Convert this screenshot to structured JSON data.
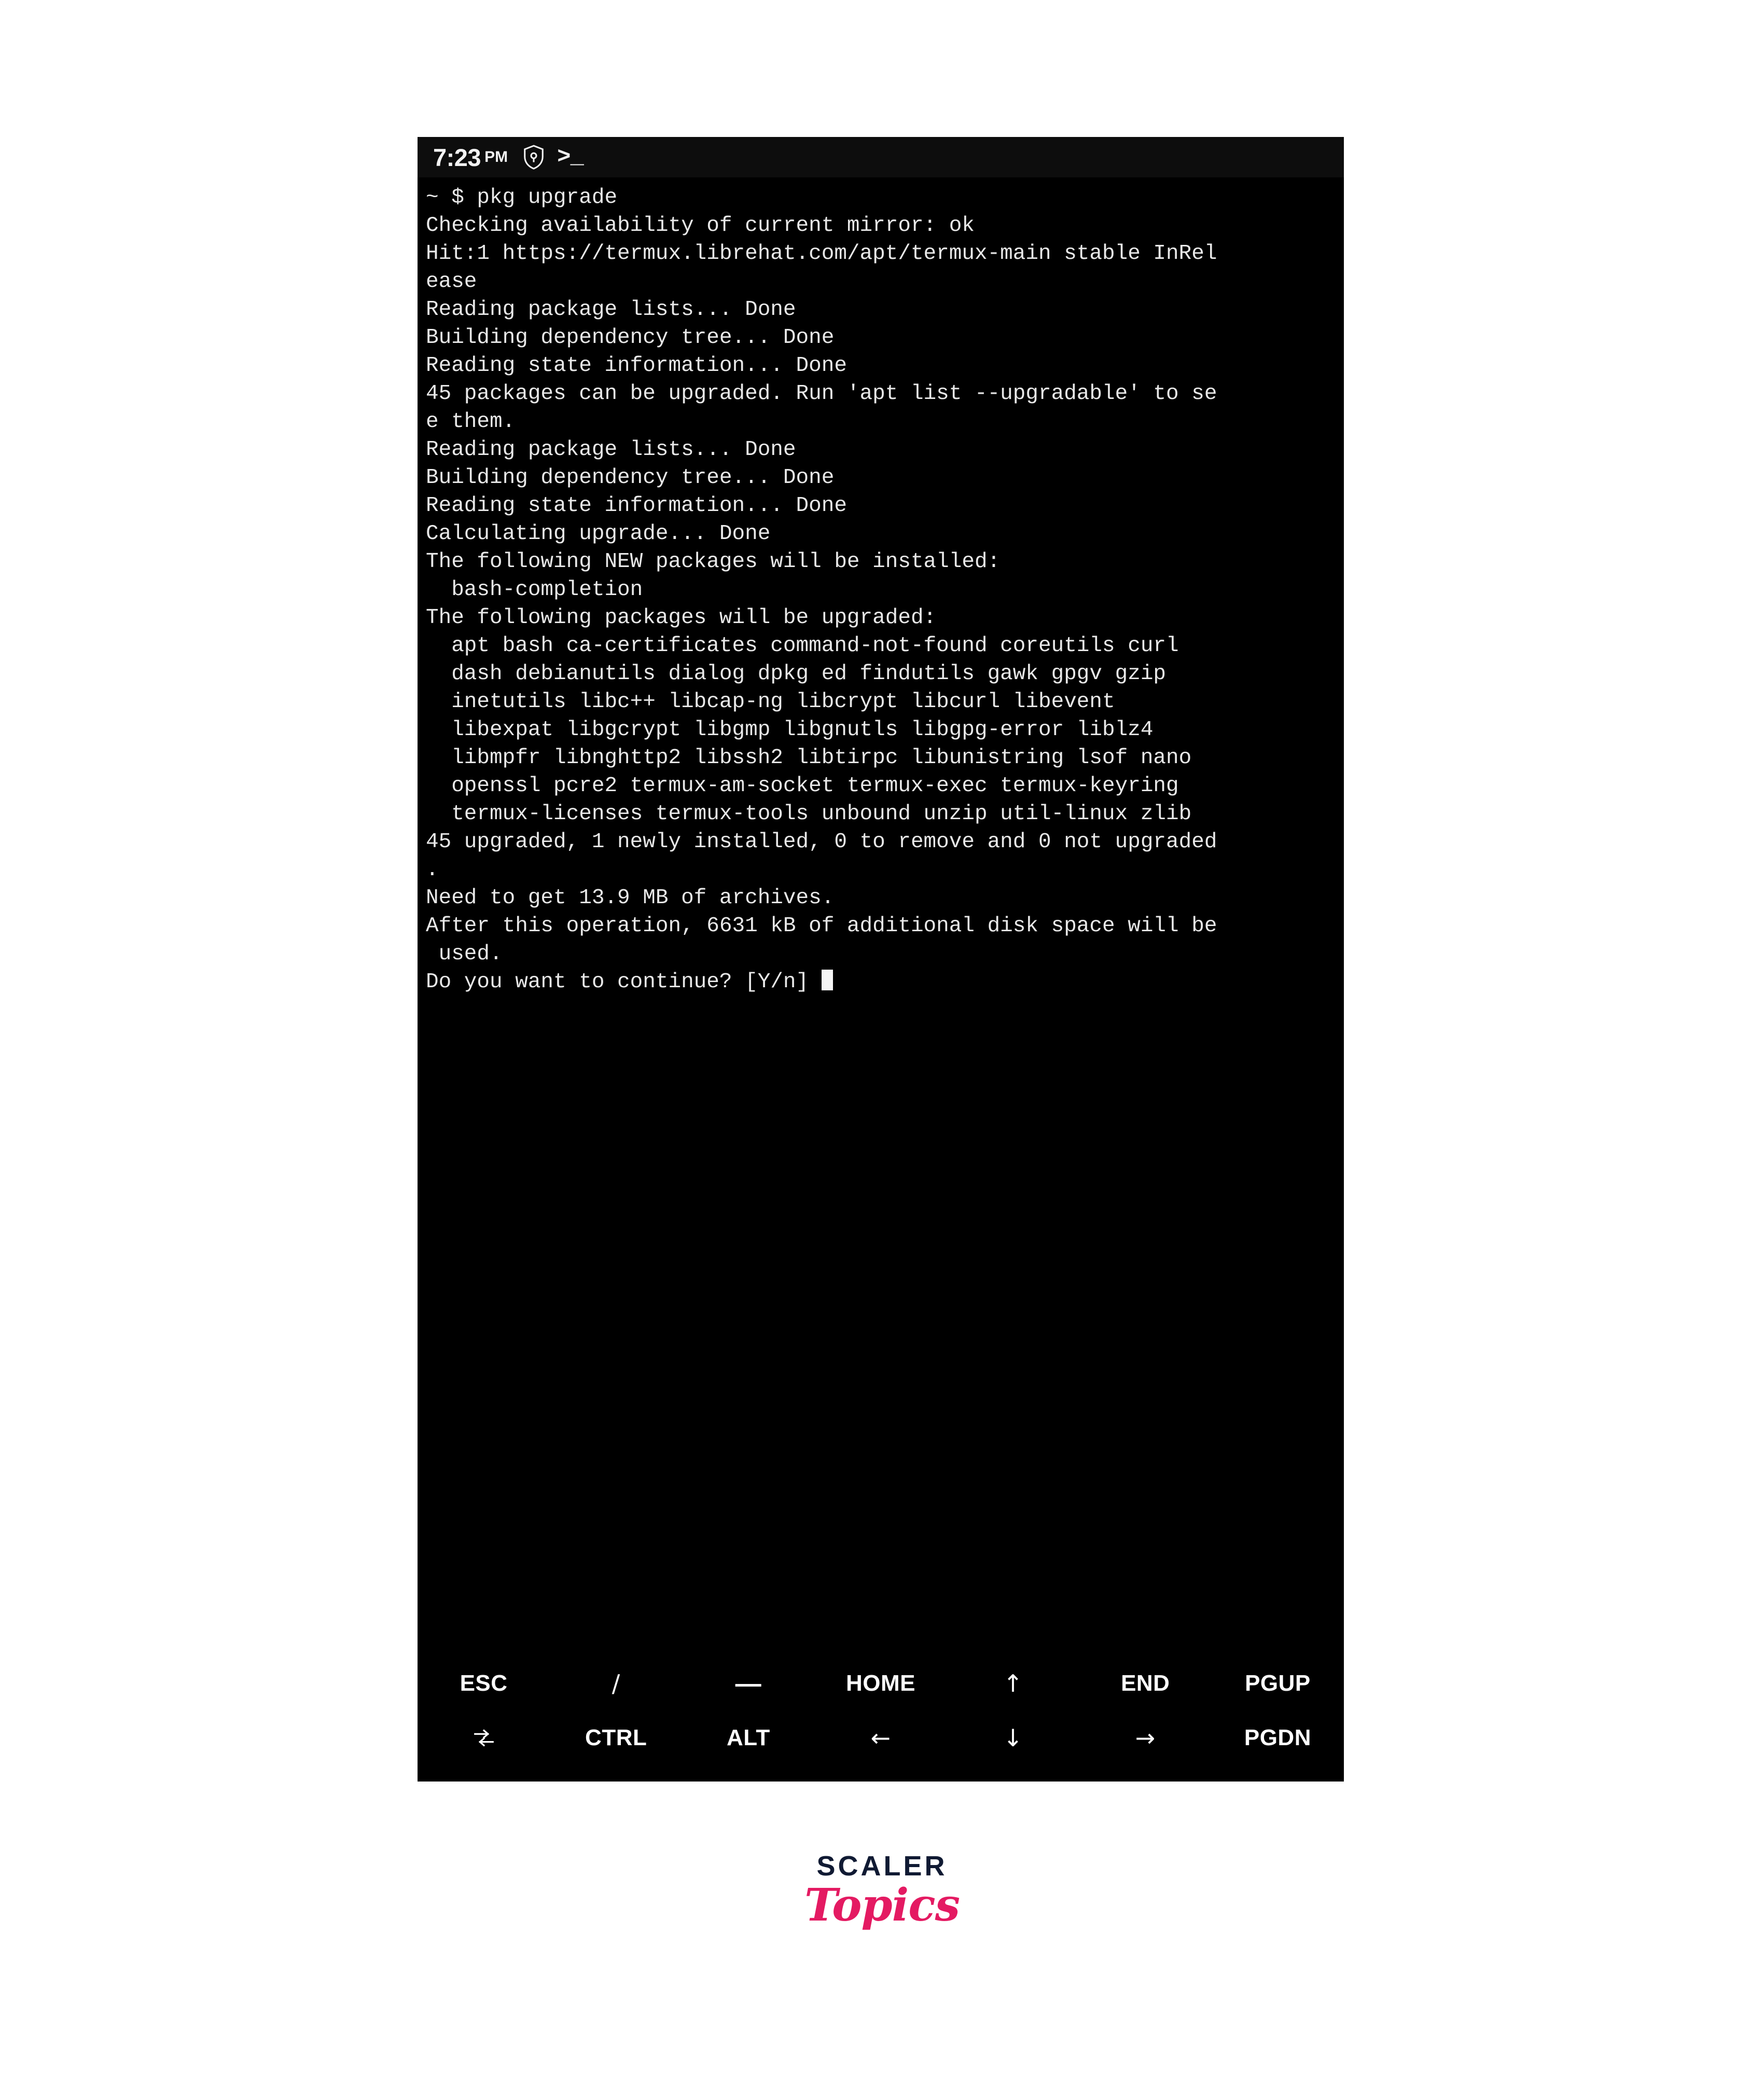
{
  "status_bar": {
    "clock": "7:23",
    "meridiem": "PM",
    "icons": [
      "shield-icon",
      "terminal-prompt-icon"
    ],
    "terminal_glyph": ">_"
  },
  "terminal": {
    "background": "#000000",
    "foreground": "#e8e8e8",
    "prompt": "~ $ ",
    "command": "pkg upgrade",
    "lines": [
      "~ $ pkg upgrade",
      "Checking availability of current mirror: ok",
      "Hit:1 https://termux.librehat.com/apt/termux-main stable InRel",
      "ease",
      "Reading package lists... Done",
      "Building dependency tree... Done",
      "Reading state information... Done",
      "45 packages can be upgraded. Run 'apt list --upgradable' to se",
      "e them.",
      "Reading package lists... Done",
      "Building dependency tree... Done",
      "Reading state information... Done",
      "Calculating upgrade... Done",
      "The following NEW packages will be installed:",
      "  bash-completion",
      "The following packages will be upgraded:",
      "  apt bash ca-certificates command-not-found coreutils curl",
      "  dash debianutils dialog dpkg ed findutils gawk gpgv gzip",
      "  inetutils libc++ libcap-ng libcrypt libcurl libevent",
      "  libexpat libgcrypt libgmp libgnutls libgpg-error liblz4",
      "  libmpfr libnghttp2 libssh2 libtirpc libunistring lsof nano",
      "  openssl pcre2 termux-am-socket termux-exec termux-keyring",
      "  termux-licenses termux-tools unbound unzip util-linux zlib",
      "45 upgraded, 1 newly installed, 0 to remove and 0 not upgraded",
      ".",
      "Need to get 13.9 MB of archives.",
      "After this operation, 6631 kB of additional disk space will be",
      " used.",
      "Do you want to continue? [Y/n] "
    ],
    "cursor_after_last_line": true,
    "summary": {
      "upgradable_count": "45",
      "new_packages": [
        "bash-completion"
      ],
      "upgraded_packages": [
        "apt",
        "bash",
        "ca-certificates",
        "command-not-found",
        "coreutils",
        "curl",
        "dash",
        "debianutils",
        "dialog",
        "dpkg",
        "ed",
        "findutils",
        "gawk",
        "gpgv",
        "gzip",
        "inetutils",
        "libc++",
        "libcap-ng",
        "libcrypt",
        "libcurl",
        "libevent",
        "libexpat",
        "libgcrypt",
        "libgmp",
        "libgnutls",
        "libgpg-error",
        "liblz4",
        "libmpfr",
        "libnghttp2",
        "libssh2",
        "libtirpc",
        "libunistring",
        "lsof",
        "nano",
        "openssl",
        "pcre2",
        "termux-am-socket",
        "termux-exec",
        "termux-keyring",
        "termux-licenses",
        "termux-tools",
        "unbound",
        "unzip",
        "util-linux",
        "zlib"
      ],
      "upgraded": "45",
      "newly_installed": "1",
      "to_remove": "0",
      "not_upgraded": "0",
      "download_size": "13.9 MB",
      "disk_space": "6631 kB",
      "prompt_question": "Do you want to continue? [Y/n]",
      "mirror": "https://termux.librehat.com/apt/termux-main stable InRelease"
    }
  },
  "extra_keys": {
    "row1": [
      {
        "label": "ESC",
        "name": "key-esc"
      },
      {
        "label": "/",
        "name": "key-slash"
      },
      {
        "label": "—",
        "name": "key-dash"
      },
      {
        "label": "HOME",
        "name": "key-home"
      },
      {
        "label": "↑",
        "name": "key-arrow-up"
      },
      {
        "label": "END",
        "name": "key-end"
      },
      {
        "label": "PGUP",
        "name": "key-pgup"
      }
    ],
    "row2": [
      {
        "label": "⇥",
        "name": "key-tab"
      },
      {
        "label": "CTRL",
        "name": "key-ctrl"
      },
      {
        "label": "ALT",
        "name": "key-alt"
      },
      {
        "label": "←",
        "name": "key-arrow-left"
      },
      {
        "label": "↓",
        "name": "key-arrow-down"
      },
      {
        "label": "→",
        "name": "key-arrow-right"
      },
      {
        "label": "PGDN",
        "name": "key-pgdn"
      }
    ]
  },
  "logo": {
    "primary": "SCALER",
    "secondary": "Topics",
    "primary_color": "#101a33",
    "secondary_color": "#e41a62"
  }
}
